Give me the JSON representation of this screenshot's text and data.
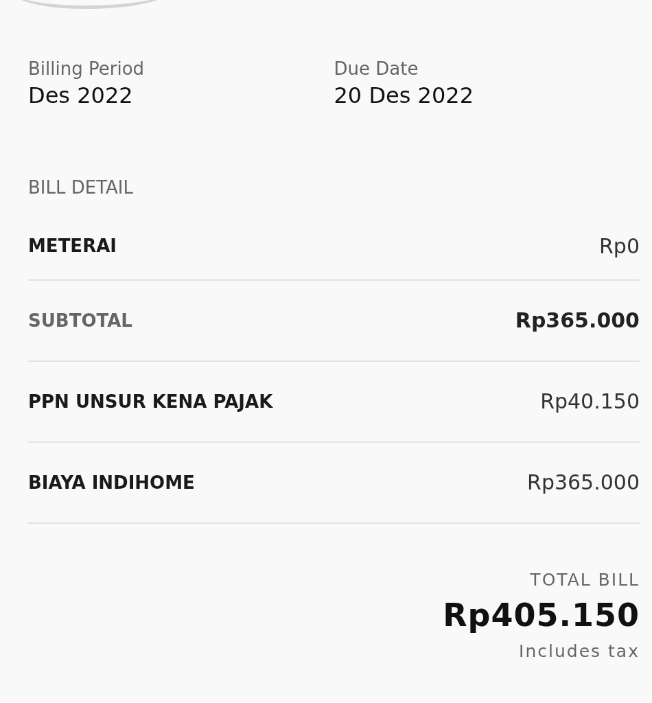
{
  "billing": [
    {
      "label": "Billing Period",
      "value": "Des 2022"
    },
    {
      "label": "Due Date",
      "value": "20 Des 2022"
    }
  ],
  "bill_detail": {
    "title": "BILL DETAIL",
    "rows": [
      {
        "kind": "item",
        "label": "METERAI",
        "amount": "Rp0"
      },
      {
        "kind": "subtotal",
        "label": "SUBTOTAL",
        "amount": "Rp365.000"
      },
      {
        "kind": "item",
        "label": "PPN UNSUR KENA PAJAK",
        "amount": "Rp40.150"
      },
      {
        "kind": "item",
        "label": "BIAYA INDIHOME",
        "amount": "Rp365.000"
      }
    ]
  },
  "total": {
    "label": "TOTAL BILL",
    "amount": "Rp405.150",
    "note": "Includes tax"
  }
}
